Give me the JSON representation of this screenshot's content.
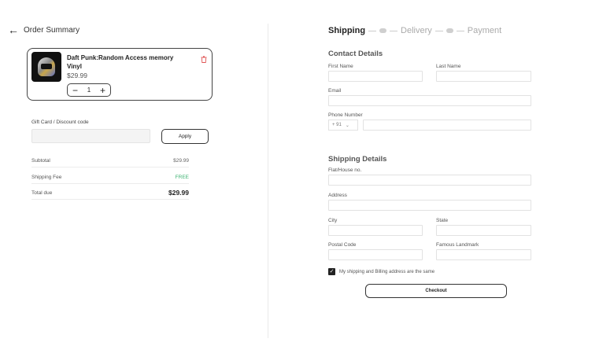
{
  "header": {
    "back_icon": "arrow-left-icon",
    "title": "Order Summary"
  },
  "product": {
    "title": "Daft Punk:Random Access memory Vinyl",
    "price": "$29.99",
    "quantity": "1",
    "minus": "−",
    "plus": "+",
    "delete_icon": "trash-icon"
  },
  "discount": {
    "label": "Gift Card / Discount code",
    "placeholder": "",
    "apply_label": "Apply"
  },
  "summary": {
    "subtotal_label": "Subtotal",
    "subtotal_value": "$29.99",
    "shipping_label": "Shipping Fee",
    "shipping_value": "FREE",
    "total_label": "Total due",
    "total_value": "$29.99"
  },
  "stepper": {
    "steps": [
      "Shipping",
      "Delivery",
      "Payment"
    ],
    "active": "Shipping"
  },
  "contact": {
    "title": "Contact Details",
    "first_name_label": "First Name",
    "last_name_label": "Last Name",
    "email_label": "Email",
    "phone_label": "Phone Number",
    "country_code": "+ 91",
    "chevron": "⌄"
  },
  "shipping": {
    "title": "Shipping Details",
    "flat_label": "Flat/House no.",
    "address_label": "Address",
    "city_label": "City",
    "state_label": "State",
    "postal_label": "Postal Code",
    "landmark_label": "Famous Landmark",
    "same_address_label": "My shipping and Billing address are the same",
    "same_address_checked": true,
    "checkout_label": "Checkout"
  },
  "colors": {
    "free_green": "#3cb371",
    "delete_red": "#e05555",
    "text_dark": "#222222"
  }
}
